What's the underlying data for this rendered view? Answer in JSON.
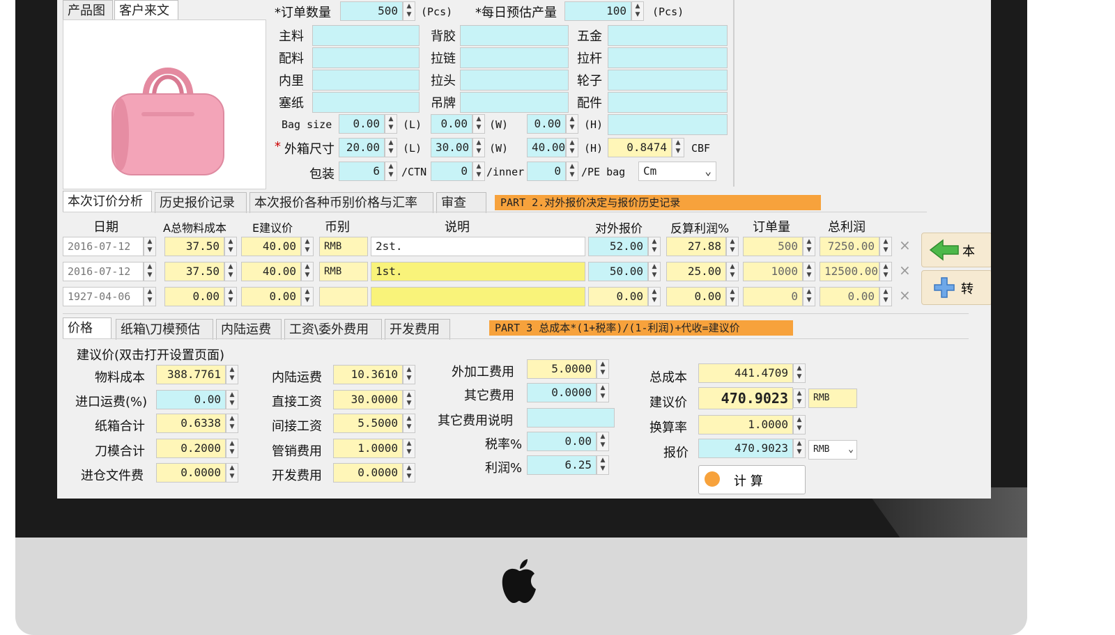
{
  "tabs_product": [
    "产品图",
    "客户来文"
  ],
  "order": {
    "qty_label": "*订单数量",
    "qty": "500",
    "qty_unit": "(Pcs)",
    "daily_label": "*每日预估产量",
    "daily": "100",
    "daily_unit": "(Pcs)"
  },
  "materials": {
    "col1": [
      "主料",
      "配料",
      "内里",
      "塞纸"
    ],
    "col2": [
      "背胶",
      "拉链",
      "拉头",
      "吊牌"
    ],
    "col3": [
      "五金",
      "拉杆",
      "轮子",
      "配件"
    ]
  },
  "bag_size": {
    "label": "Bag size",
    "l": "0.00",
    "w": "0.00",
    "h": "0.00",
    "ul": "(L)",
    "uw": "(W)",
    "uh": "(H)"
  },
  "carton": {
    "label": "外箱尺寸",
    "l": "20.00",
    "w": "30.00",
    "h": "40.00",
    "cbf": "0.8474",
    "cbf_unit": "CBF"
  },
  "packing": {
    "label": "包装",
    "ctn": "6",
    "ctn_unit": "/CTN",
    "inner": "0",
    "inner_unit": "/inner",
    "pe": "0",
    "pe_unit": "/PE bag",
    "unit_select": "Cm"
  },
  "tabs_analysis": [
    "本次订价分析",
    "历史报价记录",
    "本次报价各种币别价格与汇率",
    "审查"
  ],
  "banner2": "PART 2.对外报价决定与报价历史记录",
  "table": {
    "headers": [
      "日期",
      "A总物料成本",
      "E建议价",
      "币别",
      "说明",
      "对外报价",
      "反算利润%",
      "订单量",
      "总利润"
    ],
    "rows": [
      {
        "date": "2016-07-12",
        "cost": "37.50",
        "suggest": "40.00",
        "currency": "RMB",
        "note": "2st.",
        "quote": "52.00",
        "profit_pct": "27.88",
        "qty": "500",
        "profit": "7250.00"
      },
      {
        "date": "2016-07-12",
        "cost": "37.50",
        "suggest": "40.00",
        "currency": "RMB",
        "note": "1st.",
        "quote": "50.00",
        "profit_pct": "25.00",
        "qty": "1000",
        "profit": "12500.00"
      },
      {
        "date": "1927-04-06",
        "cost": "0.00",
        "suggest": "0.00",
        "currency": "",
        "note": "",
        "quote": "0.00",
        "profit_pct": "0.00",
        "qty": "0",
        "profit": "0.00"
      }
    ],
    "side_btn1": "本",
    "side_btn2": "转"
  },
  "tabs_cost": [
    "价格",
    "纸箱\\刀模预估",
    "内陆运费",
    "工资\\委外费用",
    "开发费用"
  ],
  "banner3": "PART 3 总成本*(1+税率)/(1-利润)+代收=建议价",
  "suggest_hint": "建议价(双击打开设置页面)",
  "costs": {
    "c1": [
      {
        "label": "物料成本",
        "value": "388.7761"
      },
      {
        "label": "进口运费(%)",
        "value": "0.00"
      },
      {
        "label": "纸箱合计",
        "value": "0.6338"
      },
      {
        "label": "刀模合计",
        "value": "0.2000"
      },
      {
        "label": "进仓文件费",
        "value": "0.0000"
      }
    ],
    "c2": [
      {
        "label": "内陆运费",
        "value": "10.3610"
      },
      {
        "label": "直接工资",
        "value": "30.0000"
      },
      {
        "label": "间接工资",
        "value": "5.5000"
      },
      {
        "label": "管销费用",
        "value": "1.0000"
      },
      {
        "label": "开发费用",
        "value": "0.0000"
      }
    ],
    "c3": [
      {
        "label": "外加工费用",
        "value": "5.0000"
      },
      {
        "label": "其它费用",
        "value": "0.0000"
      },
      {
        "label": "其它费用说明",
        "value": ""
      },
      {
        "label": "税率%",
        "value": "0.00"
      },
      {
        "label": "利润%",
        "value": "6.25"
      }
    ],
    "c4": [
      {
        "label": "总成本",
        "value": "441.4709"
      },
      {
        "label": "建议价",
        "value": "470.9023"
      },
      {
        "label": "换算率",
        "value": "1.0000"
      },
      {
        "label": "报价",
        "value": "470.9023"
      }
    ],
    "suggest_currency": "RMB",
    "quote_currency": "RMB",
    "calc_button": "计 算"
  },
  "colors": {
    "cyan": "#c8f3f7",
    "yellow": "#fff6b8",
    "orange": "#f7a23c",
    "bezel": "#1b1b1b"
  }
}
